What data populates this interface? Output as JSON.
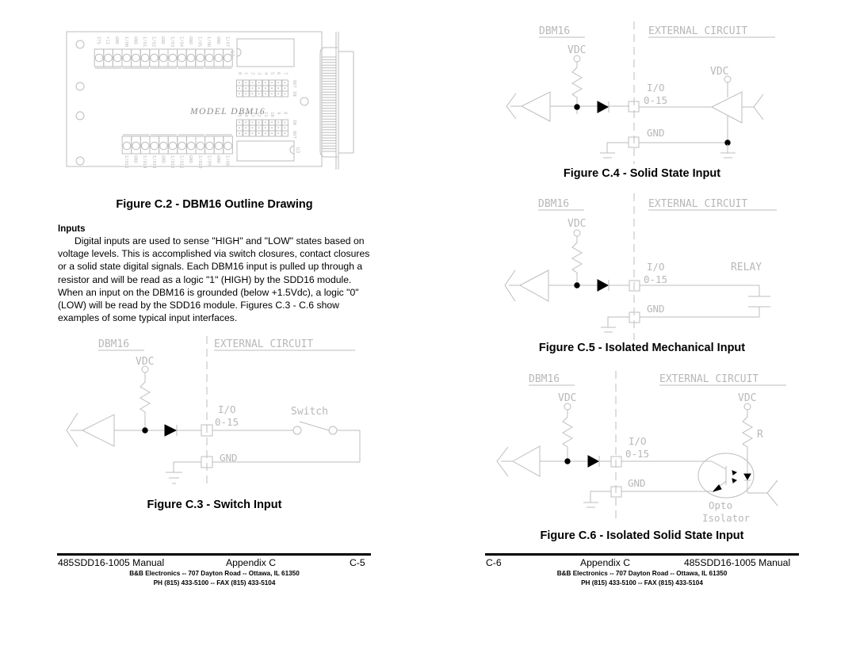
{
  "left_page": {
    "figure_c2": {
      "caption": "Figure C.2 - DBM16 Outline Drawing",
      "board_label": "MODEL DBM16",
      "top_terminals": [
        "ITS",
        "+12",
        "GND",
        "I/O0",
        "GND",
        "I/O1",
        "I/O2",
        "GND",
        "I/O3",
        "I/O4",
        "GND",
        "I/O5",
        "I/O6",
        "GND",
        "I/O7"
      ],
      "bottom_terminals": [
        "I/O15",
        "GND",
        "I/O14",
        "I/O13",
        "GND",
        "I/O12",
        "I/O11",
        "GND",
        "I/O10",
        "I/O9",
        "GND",
        "I/O8"
      ],
      "upper_jumper_numbers": [
        "0",
        "1",
        "2",
        "3",
        "4",
        "5",
        "6",
        "7"
      ],
      "lower_jumper_numbers": [
        "15",
        "14",
        "13",
        "12",
        "11",
        "10",
        "9",
        "8"
      ],
      "upper_jumper_labels": [
        "OUT",
        "IN"
      ],
      "lower_jumper_labels": [
        "IN",
        "OUT"
      ],
      "chip_u2": "U2",
      "chip_u3": "U3"
    },
    "section_heading": "Inputs",
    "paragraph": "Digital inputs are used to sense \"HIGH\" and \"LOW\" states based on voltage levels.  This is accomplished via switch closures, contact closures or a solid state digital signals.  Each DBM16 input is pulled up through a resistor and will be read as a logic \"1\" (HIGH) by the SDD16 module.  When an input on the DBM16 is grounded (below +1.5Vdc), a logic \"0\" (LOW) will be read by the SDD16 module.  Figures C.3 - C.6 show examples of some typical input interfaces.",
    "figure_c3": {
      "caption": "Figure C.3 - Switch Input",
      "left_title": "DBM16",
      "right_title": "EXTERNAL CIRCUIT",
      "vdc": "VDC",
      "io_label": "I/O",
      "io_range": "0-15",
      "gnd": "GND",
      "component": "Switch"
    },
    "footer": {
      "left": "485SDD16-1005 Manual",
      "center": "Appendix C",
      "right": "C-5",
      "company_line": "B&B Electronics  --  707 Dayton Road  --  Ottawa, IL  61350",
      "phone_line": "PH (815) 433-5100  --  FAX (815) 433-5104"
    }
  },
  "right_page": {
    "figure_c4": {
      "caption": "Figure C.4 - Solid State Input",
      "left_title": "DBM16",
      "right_title": "EXTERNAL CIRCUIT",
      "vdc": "VDC",
      "vdc_ext": "VDC",
      "io_label": "I/O",
      "io_range": "0-15",
      "gnd": "GND"
    },
    "figure_c5": {
      "caption": "Figure C.5 - Isolated Mechanical Input",
      "left_title": "DBM16",
      "right_title": "EXTERNAL CIRCUIT",
      "vdc": "VDC",
      "io_label": "I/O",
      "io_range": "0-15",
      "gnd": "GND",
      "component": "RELAY"
    },
    "figure_c6": {
      "caption": "Figure C.6 - Isolated Solid State Input",
      "left_title": "DBM16",
      "right_title": "EXTERNAL CIRCUIT",
      "vdc": "VDC",
      "vdc_ext": "VDC",
      "resistor": "R",
      "io_label": "I/O",
      "io_range": "0-15",
      "gnd": "GND",
      "component_line1": "Opto",
      "component_line2": "Isolator"
    },
    "footer": {
      "left": "C-6",
      "center": "Appendix C",
      "right": "485SDD16-1005 Manual",
      "company_line": "B&B Electronics  --  707 Dayton Road  --  Ottawa, IL  61350",
      "phone_line": "PH (815) 433-5100  --  FAX (815) 433-5104"
    }
  }
}
